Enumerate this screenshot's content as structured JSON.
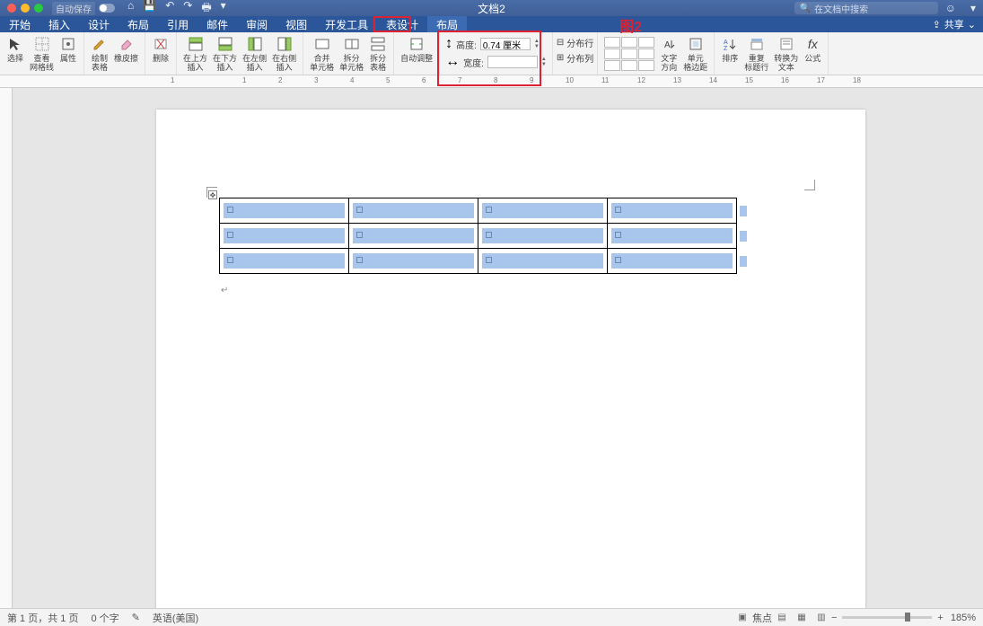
{
  "titlebar": {
    "autosave": "自动保存",
    "doc_title": "文档2",
    "search_placeholder": "在文档中搜索"
  },
  "tabs": {
    "items": [
      "开始",
      "插入",
      "设计",
      "布局",
      "引用",
      "邮件",
      "审阅",
      "视图",
      "开发工具",
      "表设计",
      "布局"
    ],
    "active_index": 10,
    "share": "共享"
  },
  "ribbon": {
    "select": "选择",
    "view_gridlines": "查看\n网格线",
    "properties": "属性",
    "draw_table": "绘制\n表格",
    "eraser": "橡皮擦",
    "delete": "删除",
    "insert_above": "在上方\n插入",
    "insert_below": "在下方\n插入",
    "insert_left": "在左侧\n插入",
    "insert_right": "在右侧\n插入",
    "merge_cells": "合并\n单元格",
    "split_cells": "拆分\n单元格",
    "split_table": "拆分\n表格",
    "autofit": "自动调整",
    "height_label": "高度:",
    "height_value": "0.74 厘米",
    "width_label": "宽度:",
    "width_value": "",
    "dist_rows": "分布行",
    "dist_cols": "分布列",
    "text_direction": "文字\n方向",
    "cell_margins": "单元\n格边距",
    "sort": "排序",
    "repeat_header": "重复\n标题行",
    "convert_text": "转换为\n文本",
    "formula": "公式",
    "fx": "fx"
  },
  "ruler_numbers": [
    "1",
    "1",
    "2",
    "3",
    "4",
    "5",
    "6",
    "7",
    "8",
    "9",
    "10",
    "11",
    "12",
    "13",
    "14",
    "15",
    "16",
    "17",
    "18"
  ],
  "annotation": {
    "label": "图2"
  },
  "status": {
    "page": "第 1 页，共 1 页",
    "words": "0 个字",
    "spell": "",
    "language": "英语(美国)",
    "focus": "焦点",
    "zoom": "185%"
  }
}
